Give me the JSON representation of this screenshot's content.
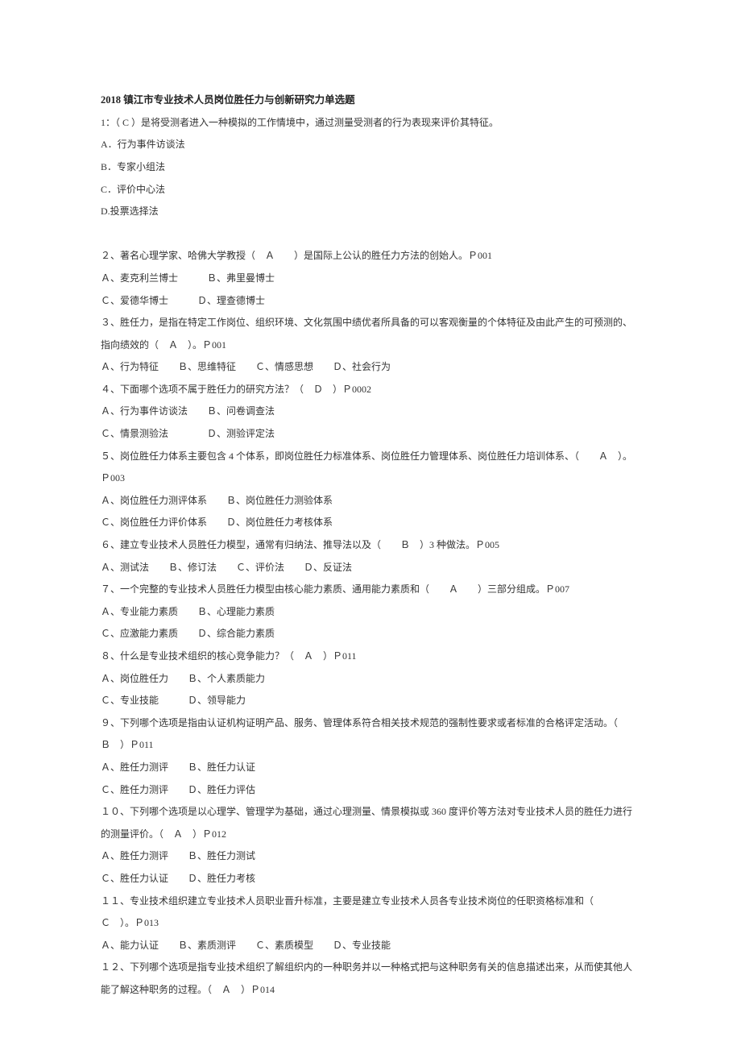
{
  "title": "2018 镇江市专业技术人员岗位胜任力与创新研究力单选题",
  "lines": [
    "1：（ C ）是将受测者进入一种模拟的工作情境中，通过测量受测者的行为表现来评价其特征。",
    "A．行为事件访谈法",
    "B．专家小组法",
    "C．评价中心法",
    "D.投票选择法",
    "",
    "２、著名心理学家、哈佛大学教授（　Ａ　　）是国际上公认的胜任力方法的创始人。Ｐ001",
    "Ａ、麦克利兰博士　　　Ｂ、弗里曼博士",
    "Ｃ、爱德华博士　　　Ｄ、理查德博士",
    "３、胜任力，是指在特定工作岗位、组织环境、文化氛围中绩优者所具备的可以客观衡量的个体特征及由此产生的可预测的、指向绩效的（　Ａ　）。Ｐ001",
    "Ａ、行为特征　　Ｂ、思维特征　　Ｃ、情感思想　　Ｄ、社会行为",
    "４、下面哪个选项不属于胜任力的研究方法？（　Ｄ　）Ｐ0002",
    "Ａ、行为事件访谈法　　Ｂ、问卷调查法",
    "Ｃ、情景测验法　　　　Ｄ、测验评定法",
    "５、岗位胜任力体系主要包含 4 个体系，即岗位胜任力标准体系、岗位胜任力管理体系、岗位胜任力培训体系、（　　Ａ　）。Ｐ003",
    "Ａ、岗位胜任力测评体系　　Ｂ、岗位胜任力测验体系",
    "Ｃ、岗位胜任力评价体系　　Ｄ、岗位胜任力考核体系",
    "６、建立专业技术人员胜任力模型，通常有归纳法、推导法以及（　　Ｂ　）3 种做法。Ｐ005",
    "Ａ、测试法　　Ｂ、修订法　　Ｃ、评价法　　Ｄ、反证法",
    "７、一个完整的专业技术人员胜任力模型由核心能力素质、通用能力素质和（　　Ａ　　）三部分组成。Ｐ007",
    "Ａ、专业能力素质　　Ｂ、心理能力素质",
    "Ｃ、应激能力素质　　Ｄ、综合能力素质",
    "８、什么是专业技术组织的核心竞争能力？（　Ａ　）Ｐ011",
    "Ａ、岗位胜任力　　Ｂ、个人素质能力",
    "Ｃ、专业技能　　　Ｄ、领导能力",
    "９、下列哪个选项是指由认证机构证明产品、服务、管理体系符合相关技术规范的强制性要求或者标准的合格评定活动。（　Ｂ　）Ｐ011",
    "Ａ、胜任力测评　　Ｂ、胜任力认证",
    "Ｃ、胜任力测评　　Ｄ、胜任力评估",
    "１０、下列哪个选项是以心理学、管理学为基础，通过心理测量、情景模拟或 360 度评价等方法对专业技术人员的胜任力进行的测量评价。（　Ａ　）Ｐ012",
    "Ａ、胜任力测评　　Ｂ、胜任力测试",
    "Ｃ、胜任力认证　　Ｄ、胜任力考核",
    "１１、专业技术组织建立专业技术人员职业晋升标准，主要是建立专业技术人员各专业技术岗位的任职资格标准和（　　Ｃ　）。Ｐ013",
    "Ａ、能力认证　　Ｂ、素质测评　　Ｃ、素质模型　　Ｄ、专业技能",
    "１２、下列哪个选项是指专业技术组织了解组织内的一种职务并以一种格式把与这种职务有关的信息描述出来，从而使其他人能了解这种职务的过程。（　Ａ　）Ｐ014"
  ]
}
